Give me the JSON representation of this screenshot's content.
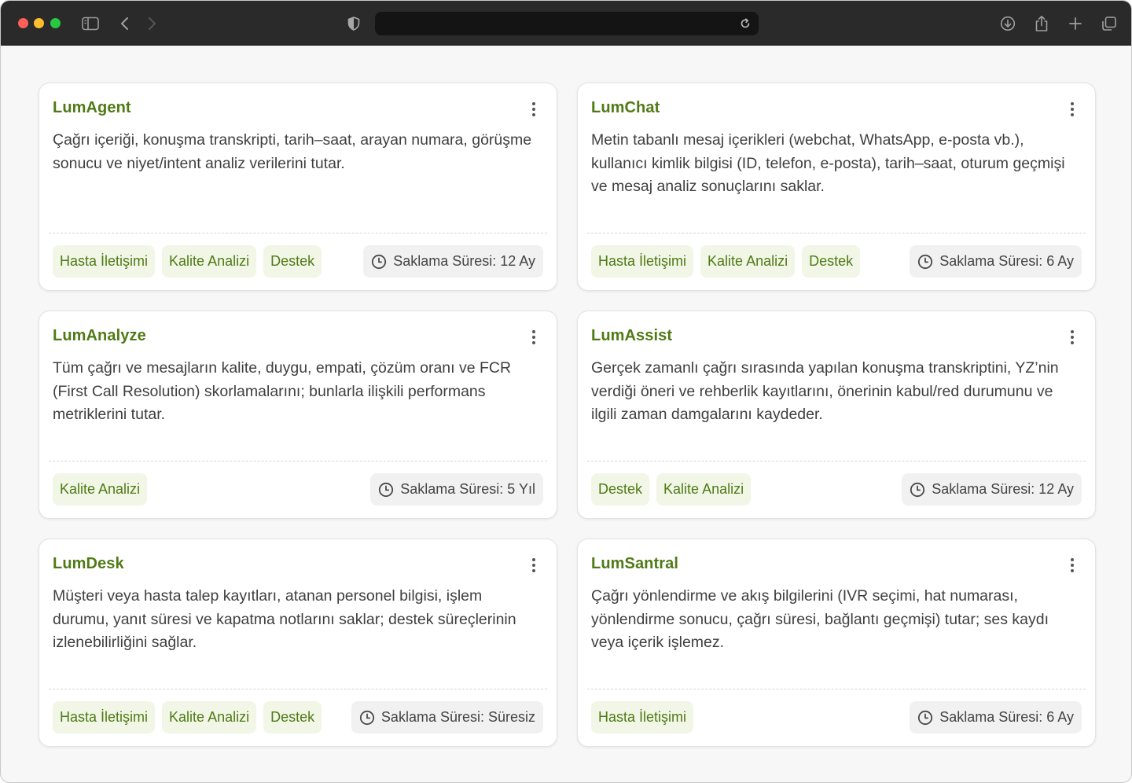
{
  "browser": {
    "icons": {
      "sidebar": "sidebar-icon",
      "back": "chevron-left-icon",
      "forward": "chevron-right-icon",
      "shield": "privacy-shield-icon",
      "reload": "reload-icon",
      "download": "download-icon",
      "share": "share-icon",
      "new_tab": "plus-icon",
      "tabs": "tab-overview-icon"
    },
    "url": ""
  },
  "colors": {
    "accent": "#4f7a16",
    "tag_bg": "#f1f6e6",
    "retention_bg": "#f1f1f1"
  },
  "cards": [
    {
      "title": "LumAgent",
      "description": "Çağrı içeriği, konuşma transkripti, tarih–saat, arayan numara, görüşme sonucu ve niyet/intent analiz verilerini tutar.",
      "tags": [
        "Hasta İletişimi",
        "Kalite Analizi",
        "Destek"
      ],
      "retention": "Saklama Süresi: 12 Ay"
    },
    {
      "title": "LumChat",
      "description": "Metin tabanlı mesaj içerikleri (webchat, WhatsApp, e-posta vb.), kullanıcı kimlik bilgisi (ID, telefon, e-posta), tarih–saat, oturum geçmişi ve mesaj analiz sonuçlarını saklar.",
      "tags": [
        "Hasta İletişimi",
        "Kalite Analizi",
        "Destek"
      ],
      "retention": "Saklama Süresi: 6 Ay"
    },
    {
      "title": "LumAnalyze",
      "description": "Tüm çağrı ve mesajların kalite, duygu, empati, çözüm oranı ve FCR (First Call Resolution) skorlamalarını; bunlarla ilişkili performans metriklerini tutar.",
      "tags": [
        "Kalite Analizi"
      ],
      "retention": "Saklama Süresi: 5 Yıl"
    },
    {
      "title": "LumAssist",
      "description": "Gerçek zamanlı çağrı sırasında yapılan konuşma transkriptini, YZ’nin verdiği öneri ve rehberlik kayıtlarını, önerinin kabul/red durumunu ve ilgili zaman damgalarını kaydeder.",
      "tags": [
        "Destek",
        "Kalite Analizi"
      ],
      "retention": "Saklama Süresi: 12 Ay"
    },
    {
      "title": "LumDesk",
      "description": "Müşteri veya hasta talep kayıtları, atanan personel bilgisi, işlem durumu, yanıt süresi ve kapatma notlarını saklar; destek süreçlerinin izlenebilirliğini sağlar.",
      "tags": [
        "Hasta İletişimi",
        "Kalite Analizi",
        "Destek"
      ],
      "retention": "Saklama Süresi: Süresiz"
    },
    {
      "title": "LumSantral",
      "description": "Çağrı yönlendirme ve akış bilgilerini (IVR seçimi, hat numarası, yönlendirme sonucu, çağrı süresi, bağlantı geçmişi) tutar; ses kaydı veya içerik işlemez.",
      "tags": [
        "Hasta İletişimi"
      ],
      "retention": "Saklama Süresi: 6 Ay"
    }
  ]
}
